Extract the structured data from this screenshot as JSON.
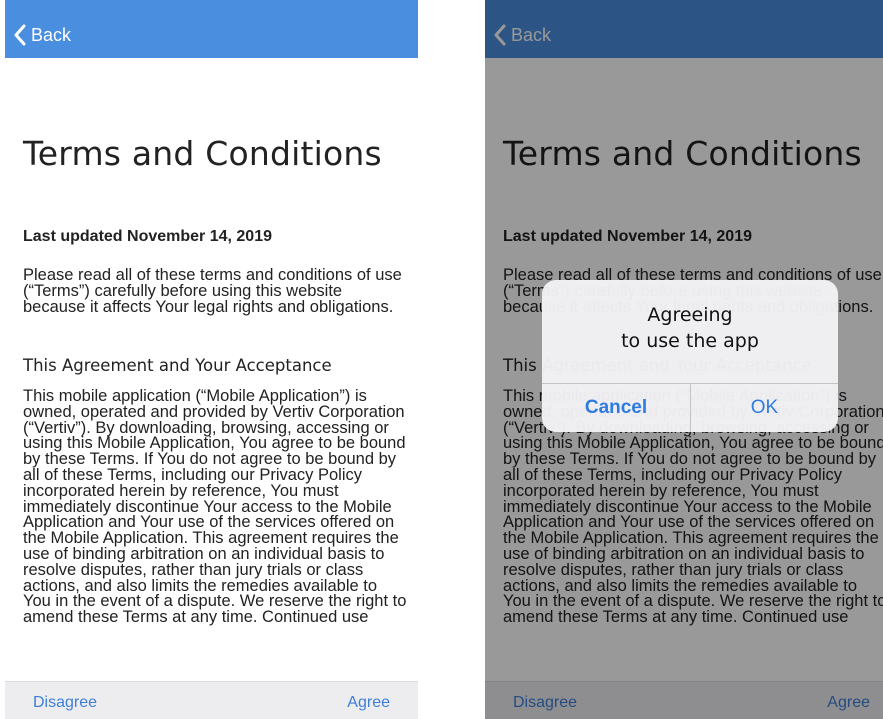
{
  "nav": {
    "back_label": "Back"
  },
  "page": {
    "title": "Terms and Conditions",
    "last_updated": "Last updated November 14, 2019",
    "intro": "Please read all of these terms and conditions of use (“Terms”) carefully before using this website because it affects Your legal rights and obligations.",
    "section_heading": "This Agreement and Your Acceptance",
    "section_body": "This mobile application (“Mobile Application”) is owned, operated and provided by Vertiv Corporation (“Vertiv”). By downloading, browsing, accessing or using this Mobile Application, You agree to be bound by these Terms. If You do not agree to be bound by all of these Terms, including our Privacy Policy incorporated herein by reference, You must immediately discontinue Your access to the Mobile Application and Your use of the services offered on the Mobile Application. This agreement requires the use of binding arbitration on an individual basis to resolve disputes, rather than jury trials or class actions, and also limits the remedies available to You in the event of a dispute. We reserve the right to amend these Terms at any time. Continued use"
  },
  "bottom_bar": {
    "disagree_label": "Disagree",
    "agree_label": "Agree"
  },
  "alert": {
    "title_line1": "Agreeing",
    "title_line2": "to use the app",
    "cancel_label": "Cancel",
    "ok_label": "OK"
  },
  "colors": {
    "nav_blue": "#4a8ee0",
    "link_blue": "#3d7fd8"
  },
  "icons": {
    "back": "chevron-left-icon"
  }
}
